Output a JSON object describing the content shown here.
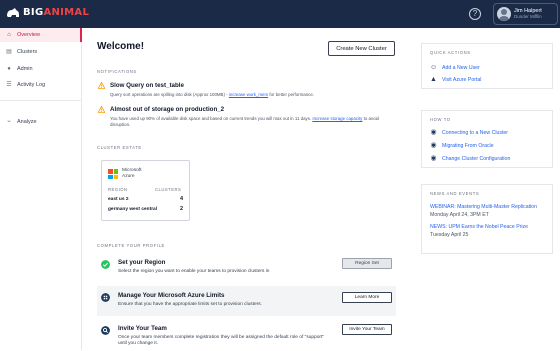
{
  "brand": {
    "prefix": "BIG",
    "suffix": "ANIMAL"
  },
  "user": {
    "name": "Jim Halpert",
    "org": "Dunder Mifflin"
  },
  "sidebar": {
    "items": [
      {
        "label": "Overview",
        "icon": "home-icon",
        "active": true
      },
      {
        "label": "Clusters",
        "icon": "database-icon",
        "active": false
      },
      {
        "label": "Admin",
        "icon": "person-icon",
        "active": false
      },
      {
        "label": "Activity Log",
        "icon": "log-icon",
        "active": false
      },
      {
        "label": "Analyze",
        "icon": "chart-icon",
        "active": false
      }
    ]
  },
  "main": {
    "title": "Welcome!",
    "new_cluster_label": "Create New Cluster",
    "notifications_heading": "NOTIFICATIONS",
    "notifications": [
      {
        "title": "Slow Query on test_table",
        "body_before": "Query sort operations are spilling into disk (Approx 100MB) - ",
        "link": "increase work_mem",
        "body_after": " for better performance."
      },
      {
        "title": "Almost out of storage on production_2",
        "body_before": "You have used up 90% of available disk space and based on current trends you will max out in 11 days. ",
        "link": "Increase storage capacity",
        "body_after": " to avoid disruption."
      }
    ],
    "cluster_estate_heading": "CLUSTER ESTATE",
    "cluster_card": {
      "provider_line1": "Microsoft",
      "provider_line2": "Azure",
      "region_header": "REGION",
      "clusters_header": "CLUSTERS",
      "rows": [
        {
          "region": "east us 2",
          "count": "4"
        },
        {
          "region": "germany west central",
          "count": "2"
        }
      ]
    },
    "profile_heading": "COMPLETE YOUR PROFILE",
    "profile_steps": [
      {
        "title": "Set your Region",
        "desc": "Select the region you want to enable your teams to provision clusters in",
        "button": "Region Set",
        "done": true
      },
      {
        "title": "Manage Your Microsoft Azure Limits",
        "desc": "Ensure that you have the appropriate limits set to provision clusters.",
        "button": "Learn More",
        "done": false
      },
      {
        "title": "Invite Your Team",
        "desc": "Once your team members complete registration they will be assigned the default role of \"support\" until you change it.",
        "button": "Invite Your Team",
        "done": false
      }
    ]
  },
  "right": {
    "quick_actions": {
      "heading": "QUICK ACTIONS",
      "items": [
        {
          "label": "Add a New User",
          "icon": "add-user-icon"
        },
        {
          "label": "Visit Azure Portal",
          "icon": "azure-icon"
        }
      ]
    },
    "how_to": {
      "heading": "HOW TO",
      "items": [
        {
          "label": "Connecting to a New Cluster",
          "icon": "connect-icon"
        },
        {
          "label": "Migrating From Oracle",
          "icon": "migrate-icon"
        },
        {
          "label": "Change Cluster Configuration",
          "icon": "config-icon"
        }
      ]
    },
    "news": {
      "heading": "NEWS AND EVENTS",
      "items": [
        {
          "title": "WEBINAR: Mastering Multi-Master Replication",
          "date": "Monday April 24, 3PM ET"
        },
        {
          "title": "NEWS: UPM Earns the Nobel Peace Prize",
          "date": "Tuesday April 25"
        }
      ]
    }
  },
  "colors": {
    "topbar": "#1b2a47",
    "accent": "#dc2650",
    "link": "#2563eb",
    "warning": "#f59e0b",
    "success": "#22c55e"
  }
}
